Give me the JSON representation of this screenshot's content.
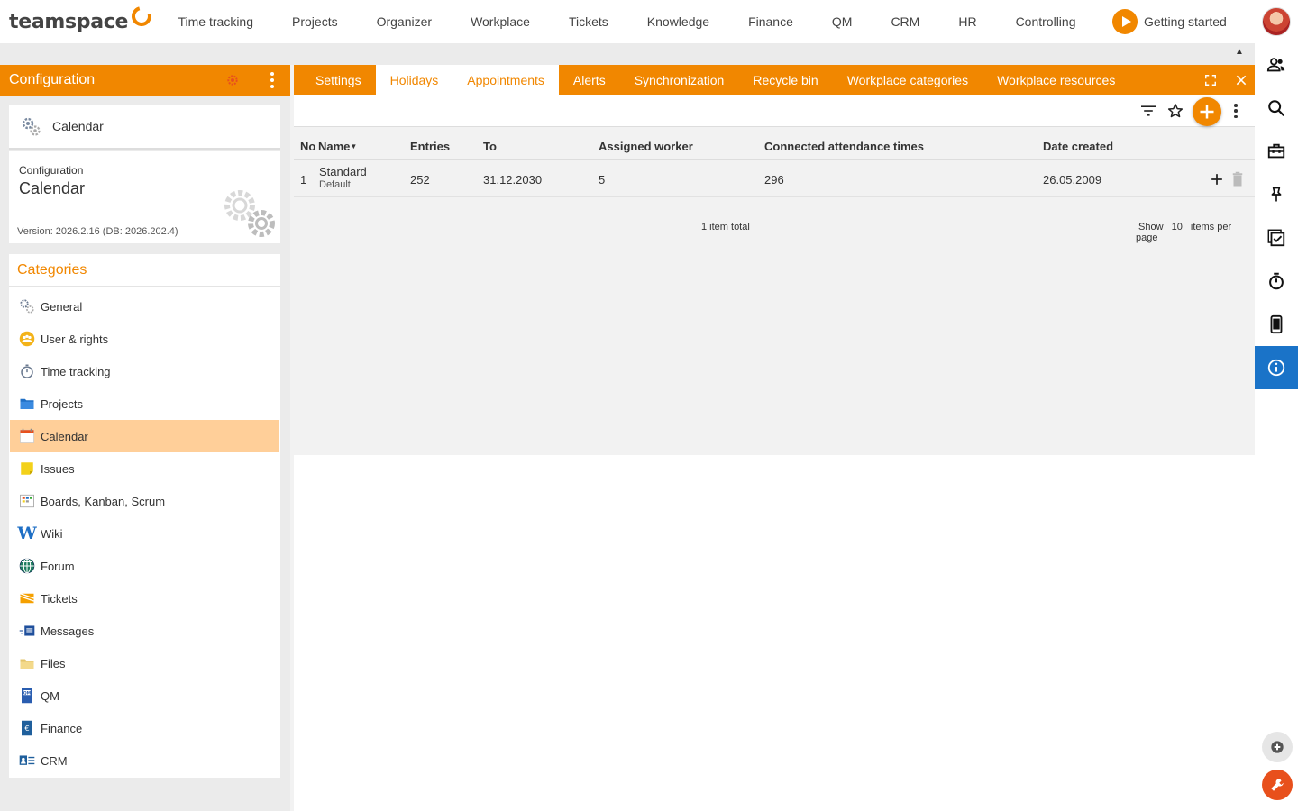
{
  "app": {
    "logo_text": "teamspace"
  },
  "topnav": {
    "items": [
      "Time tracking",
      "Projects",
      "Organizer",
      "Workplace",
      "Tickets",
      "Knowledge",
      "Finance",
      "QM",
      "CRM",
      "HR",
      "Controlling"
    ],
    "getting_started": "Getting started"
  },
  "left_panel": {
    "title": "Configuration",
    "selected_card": "Calendar",
    "info": {
      "label": "Configuration",
      "name": "Calendar",
      "version": "Version: 2026.2.16 (DB: 2026.202.4)"
    },
    "categories_title": "Categories",
    "categories": [
      "General",
      "User & rights",
      "Time tracking",
      "Projects",
      "Calendar",
      "Issues",
      "Boards, Kanban, Scrum",
      "Wiki",
      "Forum",
      "Tickets",
      "Messages",
      "Files",
      "QM",
      "Finance",
      "CRM"
    ],
    "active_category": "Calendar"
  },
  "tabs": {
    "items": [
      "Settings",
      "Holidays",
      "Appointments",
      "Alerts",
      "Synchronization",
      "Recycle bin",
      "Workplace categories",
      "Workplace resources"
    ],
    "active": "Holidays"
  },
  "table": {
    "columns": {
      "no": "No",
      "name": "Name",
      "entries": "Entries",
      "to": "To",
      "assigned_worker": "Assigned worker",
      "connected": "Connected attendance times",
      "date_created": "Date created"
    },
    "rows": [
      {
        "no": "1",
        "name": "Standard",
        "sub": "Default",
        "entries": "252",
        "to": "31.12.2030",
        "assigned_worker": "5",
        "connected": "296",
        "date_created": "26.05.2009"
      }
    ],
    "total": "1 item total",
    "show": "Show",
    "per_page": "10",
    "items_per_page": "items per page"
  },
  "colors": {
    "accent": "#f18700",
    "active_cat": "#ffcf99",
    "rail_active": "#1a73c8",
    "danger": "#e8501c"
  },
  "icons": [
    "people-icon",
    "search-icon",
    "briefcase-icon",
    "pin-icon",
    "task-check-icon",
    "stopwatch-icon",
    "mobile-icon",
    "info-icon",
    "plus-circle-icon",
    "wrench-icon"
  ]
}
